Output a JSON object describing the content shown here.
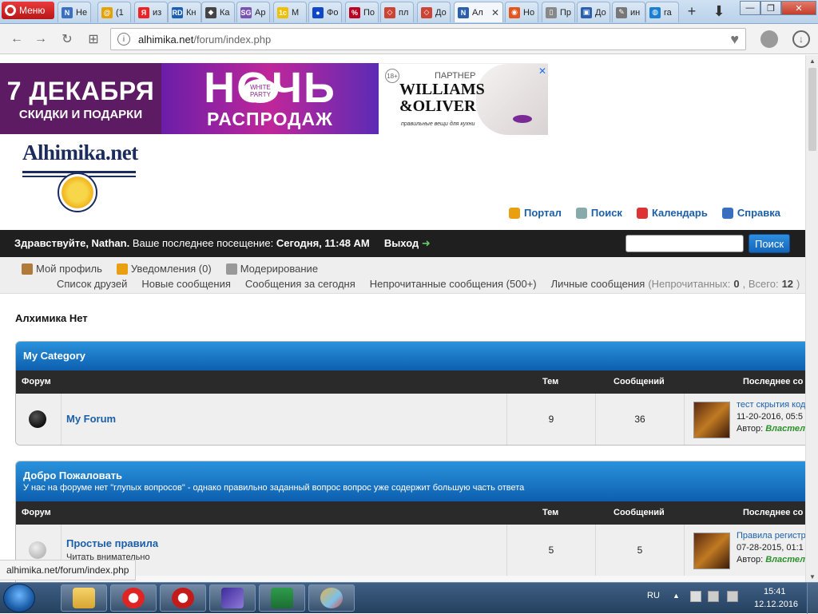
{
  "browser": {
    "menu_label": "Меню",
    "tabs": [
      {
        "label": "Не",
        "fav_color": "#3b6fc2",
        "fav_text": "N"
      },
      {
        "label": "(1",
        "fav_color": "#e6a100",
        "fav_text": "@"
      },
      {
        "label": "из",
        "fav_color": "#e22",
        "fav_text": "Я"
      },
      {
        "label": "Кн",
        "fav_color": "#1a5fb4",
        "fav_text": "RD"
      },
      {
        "label": "Ка",
        "fav_color": "#444",
        "fav_text": "◆"
      },
      {
        "label": "Ар",
        "fav_color": "#7a52b5",
        "fav_text": "SG"
      },
      {
        "label": "М",
        "fav_color": "#f0c000",
        "fav_text": "1c"
      },
      {
        "label": "Фо",
        "fav_color": "#1046c8",
        "fav_text": "●"
      },
      {
        "label": "По",
        "fav_color": "#b02",
        "fav_text": "%"
      },
      {
        "label": "пл",
        "fav_color": "#c43",
        "fav_text": "◇"
      },
      {
        "label": "До",
        "fav_color": "#c43",
        "fav_text": "◇"
      },
      {
        "label": "Ал",
        "fav_color": "#2a5fae",
        "fav_text": "N",
        "active": true
      },
      {
        "label": "Но",
        "fav_color": "#e4551d",
        "fav_text": "◉"
      },
      {
        "label": "Пр",
        "fav_color": "#888",
        "fav_text": "▯"
      },
      {
        "label": "До",
        "fav_color": "#2a5fae",
        "fav_text": "▣"
      },
      {
        "label": "ин",
        "fav_color": "#777",
        "fav_text": "✎"
      },
      {
        "label": "ra",
        "fav_color": "#1a7fd4",
        "fav_text": "◍"
      }
    ],
    "url_host": "alhimika.net",
    "url_path": "/forum/index.php",
    "status_url": "alhimika.net/forum/index.php"
  },
  "banner": {
    "date_text": "7 ДЕКАБРЯ",
    "discounts": "СКИДКИ И ПОДАРКИ",
    "night": "НОЧЬ",
    "white_party": "WHITE PARTY",
    "sale": "РАСПРОДАЖ",
    "age": "18+",
    "partner": "ПАРТНЕР",
    "brand_line1": "WILLIAMS",
    "brand_line2": "&OLIVER",
    "tagline": "правильные вещи для кухни"
  },
  "logo": {
    "text": "Alhimika.net"
  },
  "toplinks": [
    {
      "label": "Портал",
      "icon": "bell-icon",
      "color": "#e8a010"
    },
    {
      "label": "Поиск",
      "icon": "search-icon",
      "color": "#8aa"
    },
    {
      "label": "Календарь",
      "icon": "calendar-icon",
      "color": "#d33"
    },
    {
      "label": "Справка",
      "icon": "help-icon",
      "color": "#3a6fc0"
    }
  ],
  "welcome": {
    "greeting": "Здравствуйте, Nathan.",
    "last_visit_label": "Ваше последнее посещение:",
    "last_visit_value": "Сегодня, 11:48 AM",
    "logout": "Выход",
    "search_button": "Поиск"
  },
  "usermenu": {
    "row1": [
      {
        "label": "Мой профиль",
        "icon": "profile-icon",
        "color": "#b07a3a"
      },
      {
        "label": "Уведомления (0)",
        "icon": "bell-icon",
        "color": "#e8a010"
      },
      {
        "label": "Модерирование",
        "icon": "notepad-icon",
        "color": "#999"
      }
    ],
    "row2": [
      "Список друзей",
      "Новые сообщения",
      "Сообщения за сегодня",
      "Непрочитанные сообщения (500+)"
    ],
    "pm_label": "Личные сообщения",
    "pm_open": "(Непрочитанных:",
    "pm_unread": "0",
    "pm_sep": ", Всего:",
    "pm_total": "12",
    "pm_close": ")"
  },
  "forum_title": "Алхимика Нет",
  "columns": {
    "forum": "Форум",
    "threads": "Тем",
    "posts": "Сообщений",
    "last_post": "Последнее со"
  },
  "categories": [
    {
      "title": "My Category",
      "description": "",
      "forums": [
        {
          "name": "My Forum",
          "desc": "",
          "threads": "9",
          "posts": "36",
          "lp_title": "тест скрытия код",
          "lp_date": "11-20-2016, 05:5",
          "lp_author_label": "Автор:",
          "lp_author": "Властел",
          "read": false
        }
      ]
    },
    {
      "title": "Добро Пожаловать",
      "description": "У нас на форуме нет \"глупых вопросов\" - однако правильно заданный вопрос вопрос уже содержит большую часть ответа",
      "forums": [
        {
          "name": "Простые правила",
          "desc": "Читать внимательно",
          "threads": "5",
          "posts": "5",
          "lp_title": "Правила регистр",
          "lp_date": "07-28-2015, 01:1",
          "lp_author_label": "Автор:",
          "lp_author": "Властел",
          "read": true
        }
      ]
    }
  ],
  "taskbar": {
    "lang": "RU",
    "time": "15:41",
    "date": "12.12.2016"
  }
}
